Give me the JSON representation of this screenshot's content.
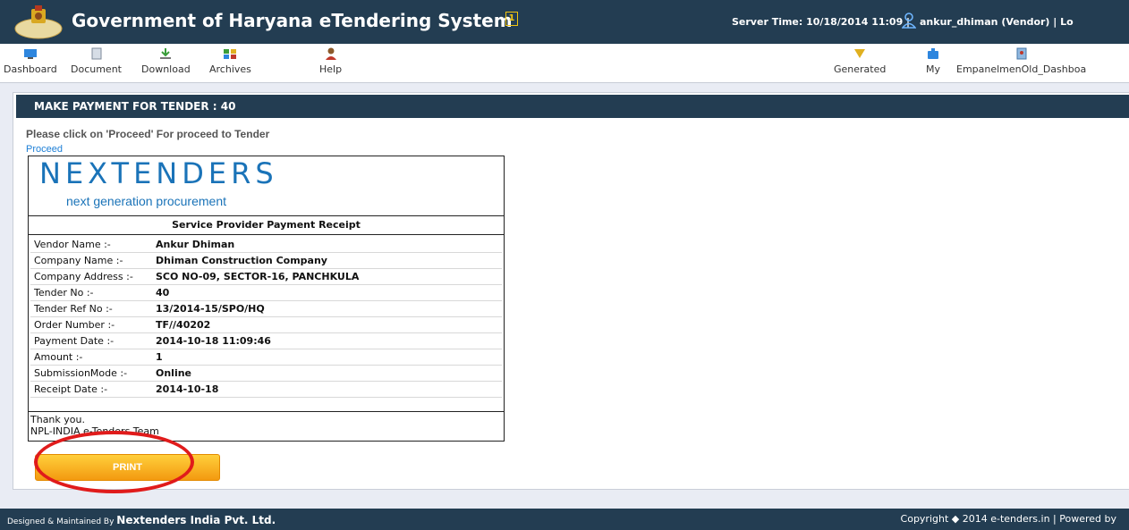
{
  "header": {
    "title": "Government of Haryana eTendering System",
    "badge": "1",
    "server_time": "Server Time: 10/18/2014 11:09 |",
    "user": "ankur_dhiman (Vendor) | Lo"
  },
  "nav": {
    "left": [
      "Dashboard",
      "Document",
      "Download",
      "Archives",
      "Help"
    ],
    "right": [
      "Generated",
      "My",
      "EmpanelmenOld_Dashboa"
    ]
  },
  "card": {
    "heading": "MAKE PAYMENT FOR TENDER : 40",
    "instruction": "Please click on 'Proceed' For proceed to Tender",
    "proceed_link": "Proceed"
  },
  "receipt": {
    "brand": "NEXTENDERS",
    "tagline": "next generation procurement",
    "title": "Service Provider Payment Receipt",
    "rows": [
      {
        "label": "Vendor Name :-",
        "value": "Ankur Dhiman"
      },
      {
        "label": "Company Name :-",
        "value": "Dhiman Construction Company"
      },
      {
        "label": "Company Address :-",
        "value": "SCO NO-09, SECTOR-16, PANCHKULA"
      },
      {
        "label": "Tender No :-",
        "value": "40"
      },
      {
        "label": "Tender Ref No :-",
        "value": "13/2014-15/SPO/HQ"
      },
      {
        "label": "Order Number :-",
        "value": "TF//40202"
      },
      {
        "label": "Payment Date :-",
        "value": "2014-10-18 11:09:46"
      },
      {
        "label": "Amount :-",
        "value": "1"
      },
      {
        "label": "SubmissionMode :-",
        "value": "Online"
      },
      {
        "label": "Receipt Date :-",
        "value": "2014-10-18"
      }
    ],
    "thanks_line1": "Thank you.",
    "thanks_line2": "NPL-INDIA e-Tenders Team"
  },
  "print_label": "PRINT",
  "footer": {
    "designed_prefix": "Designed & Maintained By ",
    "designed_company": "Nextenders India Pvt. Ltd.",
    "copyright": "Copyright ◆ 2014 e-tenders.in | Powered by"
  },
  "colors": {
    "header_bg": "#233d52",
    "brand_blue": "#1a73b8",
    "link_blue": "#1e7fd6",
    "print_orange": "#f39a10",
    "highlight_red": "#e01b1b"
  },
  "icons": [
    "haryana-emblem-icon",
    "user-icon",
    "dashboard-icon",
    "document-icon",
    "download-icon",
    "archives-icon",
    "help-icon",
    "generated-icon",
    "my-icon",
    "empanelment-icon",
    "old-dashboard-icon"
  ]
}
